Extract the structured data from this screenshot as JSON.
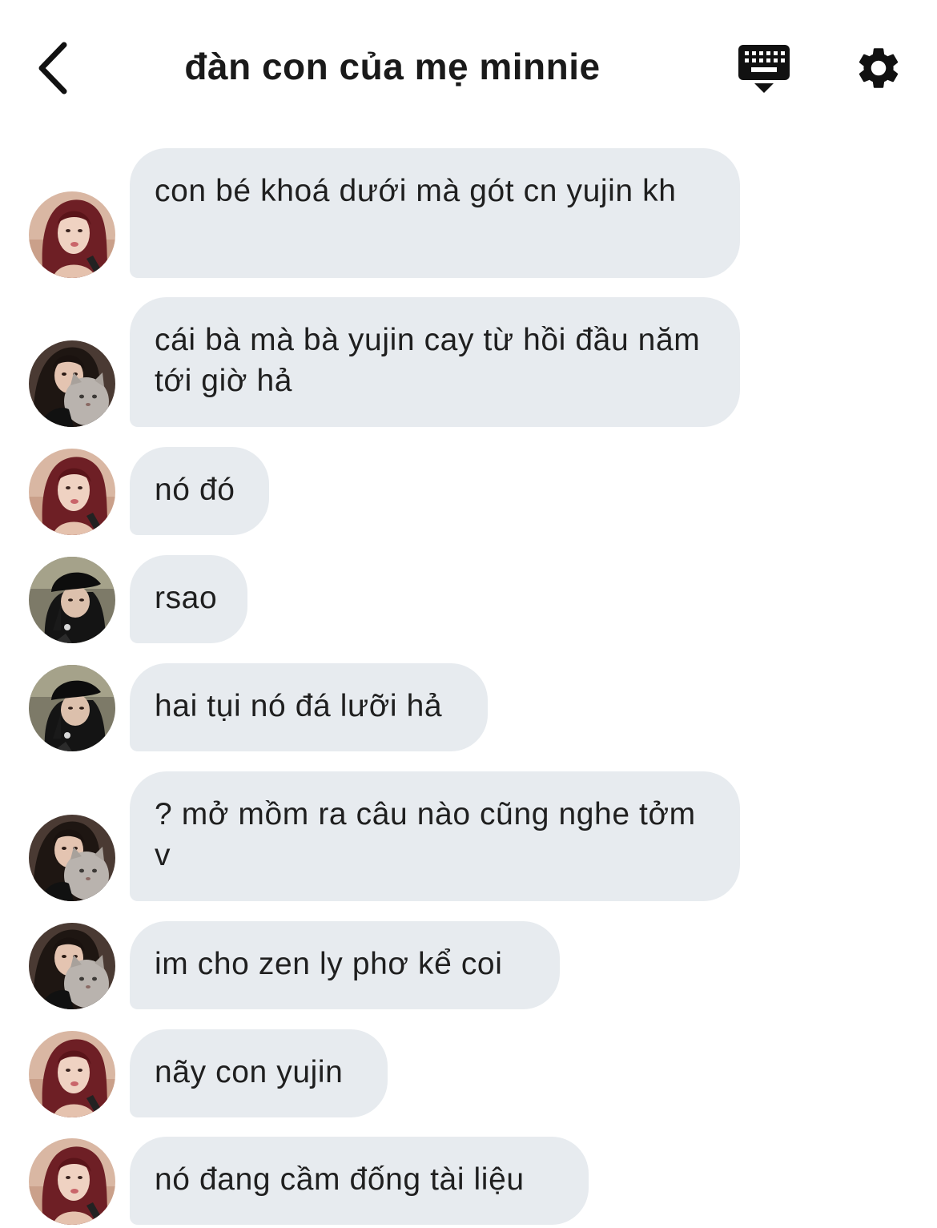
{
  "header": {
    "back_icon": "chevron-left-icon",
    "title": "đàn con của mẹ minnie",
    "keyboard_icon": "keyboard-hide-icon",
    "settings_icon": "gear-icon"
  },
  "colors": {
    "bubble": "#e7ebef",
    "text": "#1f1f1f",
    "background": "#ffffff"
  },
  "messages": [
    {
      "avatar": "avatar-red-hair",
      "text": "con bé khoá dưới mà gót cn yujin kh"
    },
    {
      "avatar": "avatar-with-cat",
      "text": "cái bà mà bà yujin cay từ hồi đầu năm tới giờ hả"
    },
    {
      "avatar": "avatar-red-hair",
      "text": "nó đó"
    },
    {
      "avatar": "avatar-black-cap",
      "text": "rsao"
    },
    {
      "avatar": "avatar-black-cap",
      "text": "hai tụi nó đá lưỡi hả"
    },
    {
      "avatar": "avatar-with-cat",
      "text": "? mở mồm ra câu nào cũng nghe tởm v"
    },
    {
      "avatar": "avatar-with-cat",
      "text": "im cho zen ly phơ kể coi"
    },
    {
      "avatar": "avatar-red-hair",
      "text": "nãy con yujin"
    },
    {
      "avatar": "avatar-red-hair",
      "text": "nó đang cầm đống tài liệu"
    }
  ]
}
